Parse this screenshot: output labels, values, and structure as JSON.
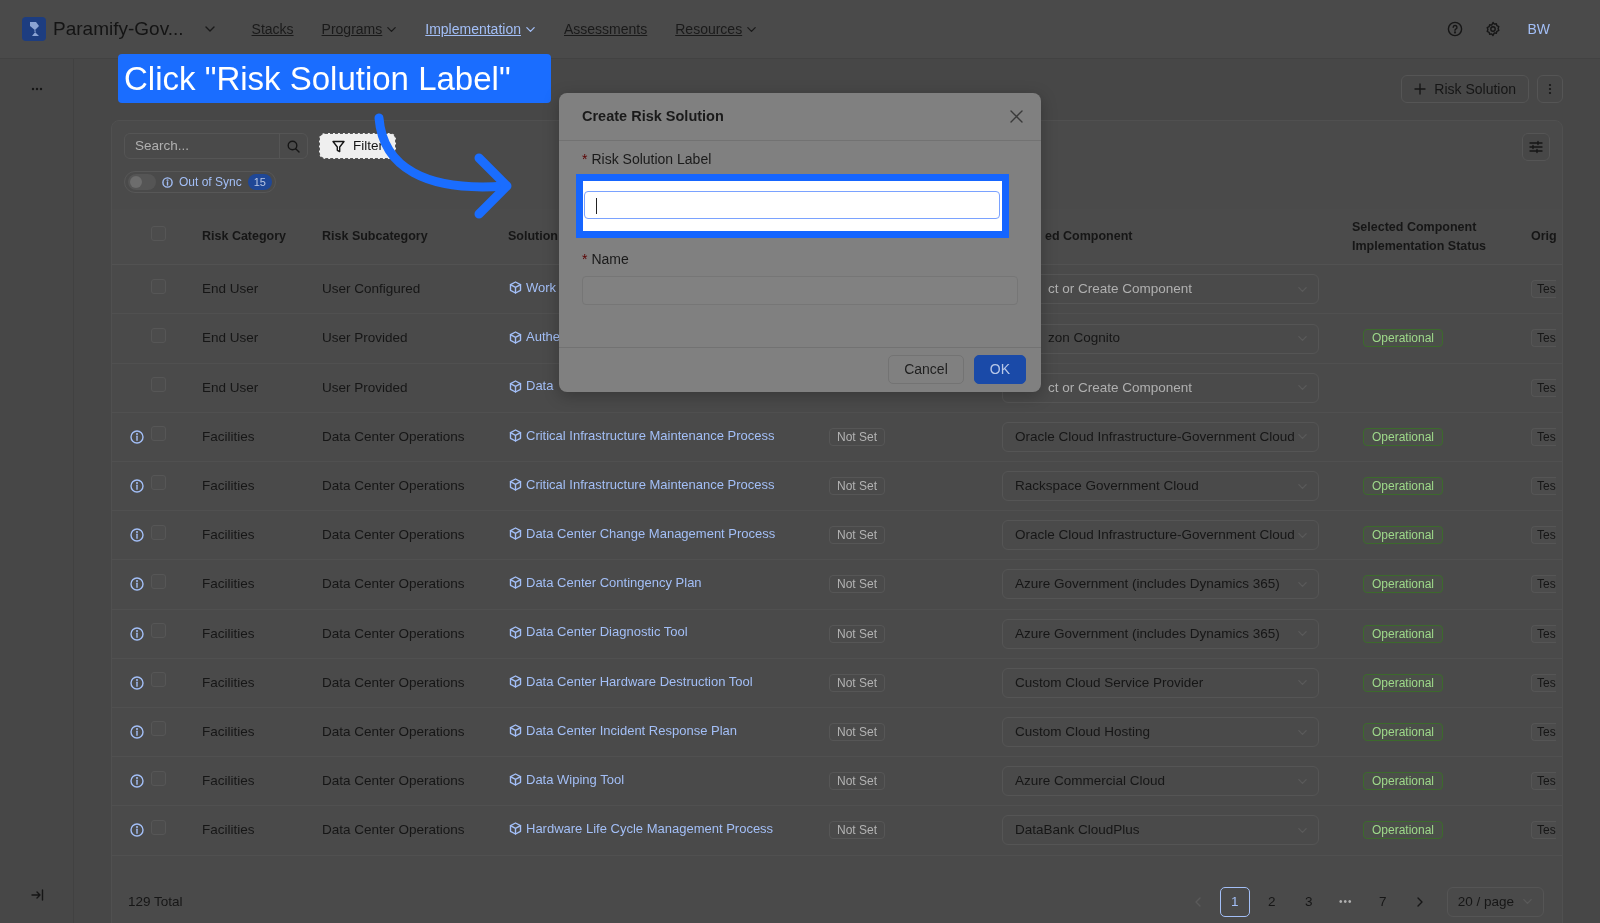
{
  "nav": {
    "brand": "Paramify-Gov...",
    "items": [
      {
        "label": "Stacks",
        "dropdown": false,
        "selected": false
      },
      {
        "label": "Programs",
        "dropdown": true,
        "selected": false
      },
      {
        "label": "Implementation",
        "dropdown": true,
        "selected": true
      },
      {
        "label": "Assessments",
        "dropdown": false,
        "selected": false
      },
      {
        "label": "Resources",
        "dropdown": true,
        "selected": false
      }
    ],
    "user_initials": "BW"
  },
  "toolbar": {
    "add_button": "Risk Solution"
  },
  "table": {
    "all_selected": false,
    "search": {
      "placeholder": "Search..."
    },
    "filter": "Filter",
    "out_of_sync": {
      "label": "Out of Sync",
      "on": false,
      "count": "15"
    },
    "columns": [
      {
        "label": "Risk Category"
      },
      {
        "label": "Risk Subcategory"
      },
      {
        "label": "Solution"
      },
      {
        "label": "ed Component",
        "under_dialog": true
      },
      {
        "label": "Selected Component Implementation Status"
      },
      {
        "label": "Orig"
      }
    ],
    "rows": [
      {
        "info": false,
        "selected": false,
        "category": "End User",
        "subcategory": "User Configured",
        "solution": "Work",
        "component": "ct or Create Component",
        "component_is_placeholder": true,
        "origin": "Tes",
        "under_dialog": true
      },
      {
        "info": false,
        "selected": false,
        "category": "End User",
        "subcategory": "User Provided",
        "solution": "Authe",
        "component": "zon Cognito",
        "component_is_placeholder": false,
        "implementation": "Operational",
        "origin": "Tes",
        "under_dialog": true
      },
      {
        "info": false,
        "selected": false,
        "category": "End User",
        "subcategory": "User Provided",
        "solution": "Data",
        "component": "ct or Create Component",
        "component_is_placeholder": true,
        "origin": "Tes",
        "under_dialog": true
      },
      {
        "info": true,
        "selected": false,
        "category": "Facilities",
        "subcategory": "Data Center Operations",
        "solution": "Critical Infrastructure Maintenance Process",
        "status": "Not Set",
        "component": "Oracle Cloud Infrastructure-Government Cloud",
        "component_is_placeholder": false,
        "implementation": "Operational",
        "origin": "Tes",
        "under_dialog": false
      },
      {
        "info": true,
        "selected": false,
        "category": "Facilities",
        "subcategory": "Data Center Operations",
        "solution": "Critical Infrastructure Maintenance Process",
        "status": "Not Set",
        "component": "Rackspace Government Cloud",
        "component_is_placeholder": false,
        "implementation": "Operational",
        "origin": "Tes",
        "under_dialog": false
      },
      {
        "info": true,
        "selected": false,
        "category": "Facilities",
        "subcategory": "Data Center Operations",
        "solution": "Data Center Change Management Process",
        "status": "Not Set",
        "component": "Oracle Cloud Infrastructure-Government Cloud",
        "component_is_placeholder": false,
        "implementation": "Operational",
        "origin": "Tes",
        "under_dialog": false
      },
      {
        "info": true,
        "selected": false,
        "category": "Facilities",
        "subcategory": "Data Center Operations",
        "solution": "Data Center Contingency Plan",
        "status": "Not Set",
        "component": "Azure Government (includes Dynamics 365)",
        "component_is_placeholder": false,
        "implementation": "Operational",
        "origin": "Tes",
        "under_dialog": false
      },
      {
        "info": true,
        "selected": false,
        "category": "Facilities",
        "subcategory": "Data Center Operations",
        "solution": "Data Center Diagnostic Tool",
        "status": "Not Set",
        "component": "Azure Government (includes Dynamics 365)",
        "component_is_placeholder": false,
        "implementation": "Operational",
        "origin": "Tes",
        "under_dialog": false
      },
      {
        "info": true,
        "selected": false,
        "category": "Facilities",
        "subcategory": "Data Center Operations",
        "solution": "Data Center Hardware Destruction Tool",
        "status": "Not Set",
        "component": "Custom Cloud Service Provider",
        "component_is_placeholder": false,
        "implementation": "Operational",
        "origin": "Tes",
        "under_dialog": false
      },
      {
        "info": true,
        "selected": false,
        "category": "Facilities",
        "subcategory": "Data Center Operations",
        "solution": "Data Center Incident Response Plan",
        "status": "Not Set",
        "component": "Custom Cloud Hosting",
        "component_is_placeholder": false,
        "implementation": "Operational",
        "origin": "Tes",
        "under_dialog": false
      },
      {
        "info": true,
        "selected": false,
        "category": "Facilities",
        "subcategory": "Data Center Operations",
        "solution": "Data Wiping Tool",
        "status": "Not Set",
        "component": "Azure Commercial Cloud",
        "component_is_placeholder": false,
        "implementation": "Operational",
        "origin": "Tes",
        "under_dialog": false
      },
      {
        "info": true,
        "selected": false,
        "category": "Facilities",
        "subcategory": "Data Center Operations",
        "solution": "Hardware Life Cycle Management Process",
        "status": "Not Set",
        "component": "DataBank CloudPlus",
        "component_is_placeholder": false,
        "implementation": "Operational",
        "origin": "Tes",
        "under_dialog": false
      }
    ],
    "total": "129 Total",
    "pagination": {
      "pages": [
        {
          "label": "1",
          "kind": "page",
          "selected": true
        },
        {
          "label": "2",
          "kind": "page",
          "selected": false
        },
        {
          "label": "3",
          "kind": "page",
          "selected": false
        },
        {
          "label": "•••",
          "kind": "ellipsis",
          "selected": false
        },
        {
          "label": "7",
          "kind": "page",
          "selected": false
        }
      ],
      "page_size": "20 / page"
    }
  },
  "dialog": {
    "title": "Create Risk Solution",
    "fields": [
      {
        "label": "Risk Solution Label",
        "required_mark": "*",
        "focused": true,
        "highlighted": true
      },
      {
        "label": "Name",
        "required_mark": "*",
        "focused": false,
        "highlighted": false
      }
    ],
    "buttons": [
      {
        "label": "Cancel",
        "kind": "default"
      },
      {
        "label": "OK",
        "kind": "primary"
      }
    ]
  },
  "callout": {
    "text": "Click \"Risk Solution Label\""
  }
}
